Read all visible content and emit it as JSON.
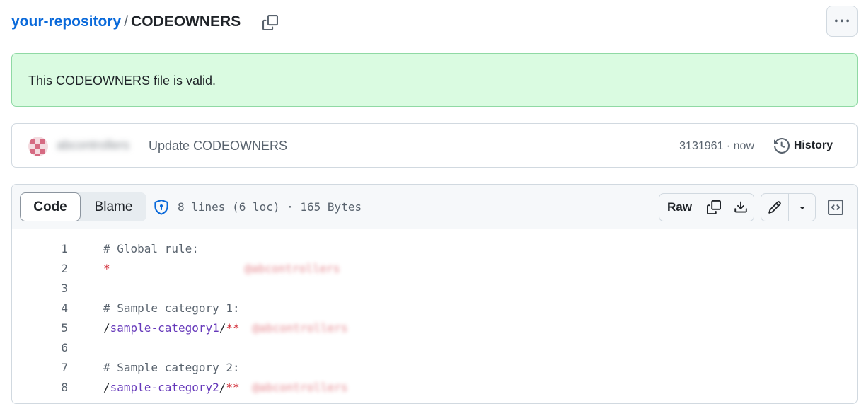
{
  "header": {
    "repo_name": "your-repository",
    "separator": "/",
    "file_name": "CODEOWNERS"
  },
  "banner": {
    "message": "This CODEOWNERS file is valid."
  },
  "commit": {
    "author": "abcontrollers",
    "message": "Update CODEOWNERS",
    "meta": "3131961 · now",
    "history_label": "History"
  },
  "file": {
    "tab_code": "Code",
    "tab_blame": "Blame",
    "info": "8 lines (6 loc) · 165 Bytes",
    "raw_label": "Raw"
  },
  "code_lines": [
    {
      "num": "1",
      "comment": "# Global rule:"
    },
    {
      "num": "2",
      "star": "*",
      "owner": "@abcontrollers"
    },
    {
      "num": "3"
    },
    {
      "num": "4",
      "comment": "# Sample category 1:"
    },
    {
      "num": "5",
      "path_prefix": "/",
      "path_name": "sample-category1",
      "path_sep": "/",
      "glob": "**",
      "owner": "@abcontrollers"
    },
    {
      "num": "6"
    },
    {
      "num": "7",
      "comment": "# Sample category 2:"
    },
    {
      "num": "8",
      "path_prefix": "/",
      "path_name": "sample-category2",
      "path_sep": "/",
      "glob": "**",
      "owner": "@abcontrollers"
    }
  ],
  "colors": {
    "link": "#0969da",
    "success_bg": "#dafbe1",
    "success_border": "#8fd9a4",
    "code_keyword": "#cf222e",
    "code_path": "#6639ba"
  },
  "icons": [
    "copy-icon",
    "kebab-icon",
    "history-icon",
    "shield-icon",
    "download-icon",
    "pencil-icon",
    "triangle-down-icon",
    "code-square-icon"
  ]
}
